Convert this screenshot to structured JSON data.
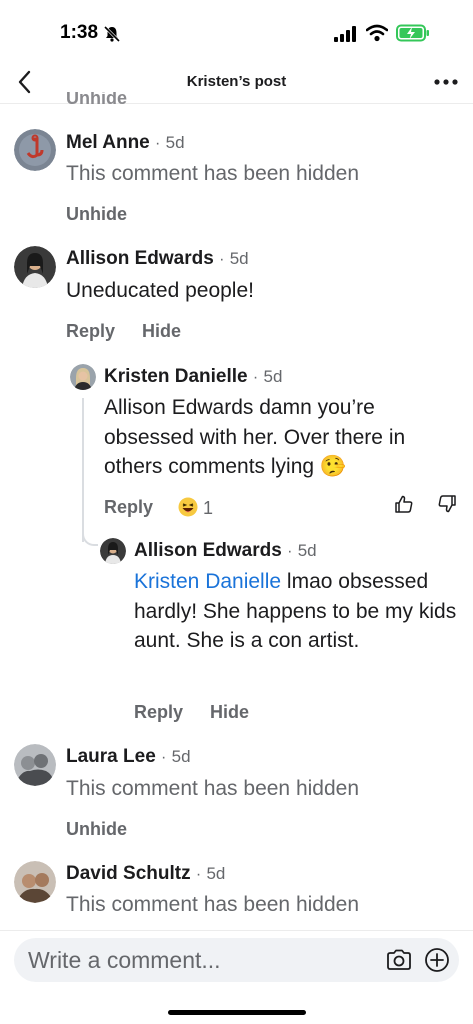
{
  "status": {
    "time": "1:38"
  },
  "header": {
    "title": "Kristen’s post"
  },
  "partial_action": "Unhide",
  "comments": [
    {
      "name": "Mel Anne",
      "time": "5d",
      "text": "This comment has been hidden",
      "action1": "Unhide"
    },
    {
      "name": "Allison Edwards",
      "time": "5d",
      "text": "Uneducated people!",
      "action1": "Reply",
      "action2": "Hide"
    },
    {
      "name": "Kristen Danielle",
      "time": "5d",
      "text": "Allison Edwards damn you’re obsessed with her. Over there in others comments lying 🤥",
      "action1": "Reply",
      "reaction_count": "1"
    },
    {
      "name": "Allison Edwards",
      "time": "5d",
      "mention": "Kristen Danielle",
      "text": "lmao obsessed hardly! She happens to be my kids aunt. She is a con artist.",
      "action1": "Reply",
      "action2": "Hide"
    },
    {
      "name": "Laura Lee",
      "time": "5d",
      "text": "This comment has been hidden",
      "action1": "Unhide"
    },
    {
      "name": "David Schultz",
      "time": "5d",
      "text": "This comment has been hidden"
    }
  ],
  "separator": "·",
  "composer": {
    "placeholder": "Write a comment..."
  },
  "icons": {
    "status": [
      "bell-slash-icon",
      "signal-icon",
      "wifi-icon",
      "battery-charging-icon"
    ],
    "header": [
      "back-icon",
      "more-icon"
    ],
    "composer": [
      "camera-icon",
      "plus-icon"
    ]
  },
  "colors": {
    "mention": "#1a73d9",
    "battery": "#34c759",
    "secondary_text": "#65676b"
  }
}
